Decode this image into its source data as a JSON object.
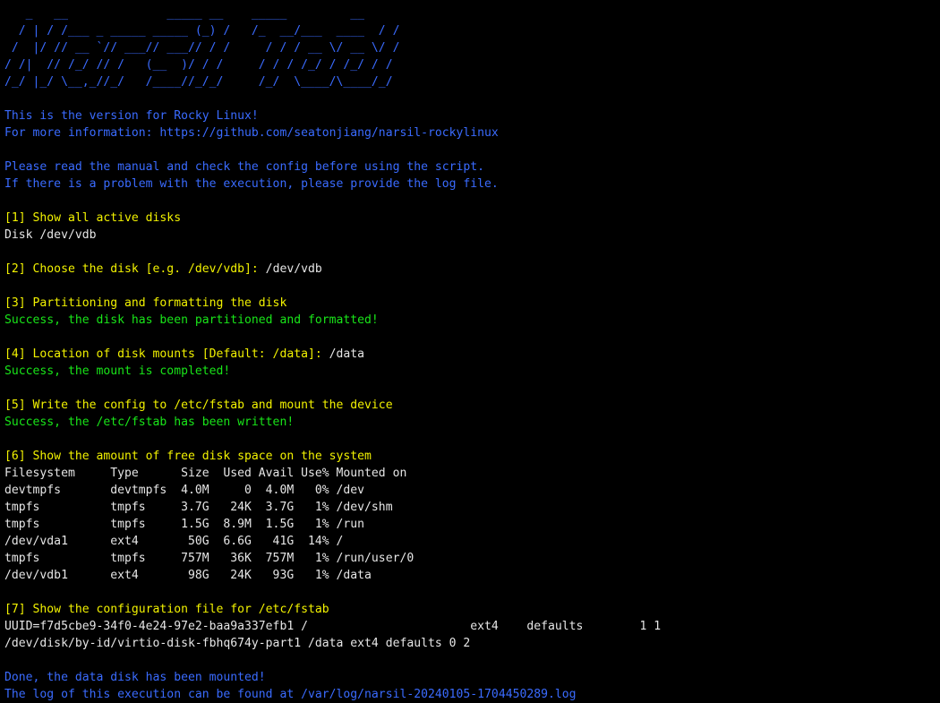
{
  "banner": {
    "ascii_art": "   _   __              _____ __    _____         __\n  / | / /___ _ _____ _____ (_) /   /_  __/___  ____  / /\n /  |/ // __ `// ___// ___// / /     / / / __ \\/ __ \\/ /\n/ /|  // /_/ // /   (__  )/ / /     / / / /_/ / /_/ / /\n/_/ |_/ \\__,_//_/   /____//_/_/     /_/  \\____/\\____/_/"
  },
  "intro": {
    "version_line": "This is the version for Rocky Linux!",
    "info_line": "For more information: https://github.com/seatonjiang/narsil-rockylinux",
    "manual_line": "Please read the manual and check the config before using the script.",
    "log_hint_line": "If there is a problem with the execution, please provide the log file."
  },
  "steps": {
    "step1": {
      "heading": "[1] Show all active disks",
      "output": "Disk /dev/vdb"
    },
    "step2": {
      "heading": "[2] Choose the disk [e.g. /dev/vdb]:",
      "input_value": " /dev/vdb"
    },
    "step3": {
      "heading": "[3] Partitioning and formatting the disk",
      "result": "Success, the disk has been partitioned and formatted!"
    },
    "step4": {
      "heading": "[4] Location of disk mounts [Default: /data]:",
      "input_value": " /data",
      "result": "Success, the mount is completed!"
    },
    "step5": {
      "heading": "[5] Write the config to /etc/fstab and mount the device",
      "result": "Success, the /etc/fstab has been written!"
    },
    "step6": {
      "heading": "[6] Show the amount of free disk space on the system",
      "table_header": "Filesystem     Type      Size  Used Avail Use% Mounted on",
      "rows": [
        "devtmpfs       devtmpfs  4.0M     0  4.0M   0% /dev",
        "tmpfs          tmpfs     3.7G   24K  3.7G   1% /dev/shm",
        "tmpfs          tmpfs     1.5G  8.9M  1.5G   1% /run",
        "/dev/vda1      ext4       50G  6.6G   41G  14% /",
        "tmpfs          tmpfs     757M   36K  757M   1% /run/user/0",
        "/dev/vdb1      ext4       98G   24K   93G   1% /data"
      ]
    },
    "step7": {
      "heading": "[7] Show the configuration file for /etc/fstab",
      "lines": [
        "UUID=f7d5cbe9-34f0-4e24-97e2-baa9a337efb1 /                       ext4    defaults        1 1",
        "/dev/disk/by-id/virtio-disk-fbhq674y-part1 /data ext4 defaults 0 2"
      ]
    }
  },
  "footer": {
    "done_line": "Done, the data disk has been mounted!",
    "log_line": "The log of this execution can be found at /var/log/narsil-20240105-1704450289.log"
  },
  "colors": {
    "background": "#000000",
    "info_blue": "#3a6bff",
    "heading_yellow": "#f2f200",
    "success_green": "#19e619",
    "output_white": "#e6e6e6"
  }
}
